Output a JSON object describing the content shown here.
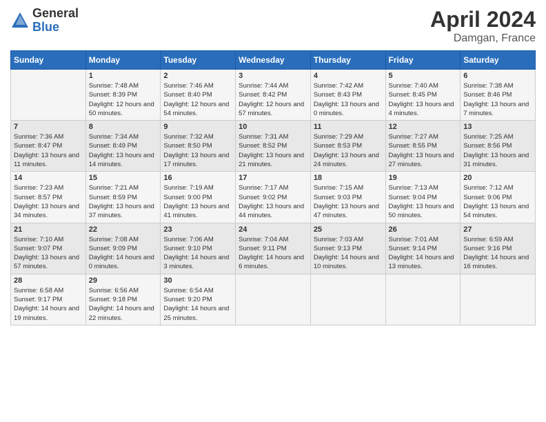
{
  "header": {
    "logo_general": "General",
    "logo_blue": "Blue",
    "month_title": "April 2024",
    "location": "Damgan, France"
  },
  "days_of_week": [
    "Sunday",
    "Monday",
    "Tuesday",
    "Wednesday",
    "Thursday",
    "Friday",
    "Saturday"
  ],
  "weeks": [
    [
      {
        "day": "",
        "sunrise": "",
        "sunset": "",
        "daylight": ""
      },
      {
        "day": "1",
        "sunrise": "Sunrise: 7:48 AM",
        "sunset": "Sunset: 8:39 PM",
        "daylight": "Daylight: 12 hours and 50 minutes."
      },
      {
        "day": "2",
        "sunrise": "Sunrise: 7:46 AM",
        "sunset": "Sunset: 8:40 PM",
        "daylight": "Daylight: 12 hours and 54 minutes."
      },
      {
        "day": "3",
        "sunrise": "Sunrise: 7:44 AM",
        "sunset": "Sunset: 8:42 PM",
        "daylight": "Daylight: 12 hours and 57 minutes."
      },
      {
        "day": "4",
        "sunrise": "Sunrise: 7:42 AM",
        "sunset": "Sunset: 8:43 PM",
        "daylight": "Daylight: 13 hours and 0 minutes."
      },
      {
        "day": "5",
        "sunrise": "Sunrise: 7:40 AM",
        "sunset": "Sunset: 8:45 PM",
        "daylight": "Daylight: 13 hours and 4 minutes."
      },
      {
        "day": "6",
        "sunrise": "Sunrise: 7:38 AM",
        "sunset": "Sunset: 8:46 PM",
        "daylight": "Daylight: 13 hours and 7 minutes."
      }
    ],
    [
      {
        "day": "7",
        "sunrise": "Sunrise: 7:36 AM",
        "sunset": "Sunset: 8:47 PM",
        "daylight": "Daylight: 13 hours and 11 minutes."
      },
      {
        "day": "8",
        "sunrise": "Sunrise: 7:34 AM",
        "sunset": "Sunset: 8:49 PM",
        "daylight": "Daylight: 13 hours and 14 minutes."
      },
      {
        "day": "9",
        "sunrise": "Sunrise: 7:32 AM",
        "sunset": "Sunset: 8:50 PM",
        "daylight": "Daylight: 13 hours and 17 minutes."
      },
      {
        "day": "10",
        "sunrise": "Sunrise: 7:31 AM",
        "sunset": "Sunset: 8:52 PM",
        "daylight": "Daylight: 13 hours and 21 minutes."
      },
      {
        "day": "11",
        "sunrise": "Sunrise: 7:29 AM",
        "sunset": "Sunset: 8:53 PM",
        "daylight": "Daylight: 13 hours and 24 minutes."
      },
      {
        "day": "12",
        "sunrise": "Sunrise: 7:27 AM",
        "sunset": "Sunset: 8:55 PM",
        "daylight": "Daylight: 13 hours and 27 minutes."
      },
      {
        "day": "13",
        "sunrise": "Sunrise: 7:25 AM",
        "sunset": "Sunset: 8:56 PM",
        "daylight": "Daylight: 13 hours and 31 minutes."
      }
    ],
    [
      {
        "day": "14",
        "sunrise": "Sunrise: 7:23 AM",
        "sunset": "Sunset: 8:57 PM",
        "daylight": "Daylight: 13 hours and 34 minutes."
      },
      {
        "day": "15",
        "sunrise": "Sunrise: 7:21 AM",
        "sunset": "Sunset: 8:59 PM",
        "daylight": "Daylight: 13 hours and 37 minutes."
      },
      {
        "day": "16",
        "sunrise": "Sunrise: 7:19 AM",
        "sunset": "Sunset: 9:00 PM",
        "daylight": "Daylight: 13 hours and 41 minutes."
      },
      {
        "day": "17",
        "sunrise": "Sunrise: 7:17 AM",
        "sunset": "Sunset: 9:02 PM",
        "daylight": "Daylight: 13 hours and 44 minutes."
      },
      {
        "day": "18",
        "sunrise": "Sunrise: 7:15 AM",
        "sunset": "Sunset: 9:03 PM",
        "daylight": "Daylight: 13 hours and 47 minutes."
      },
      {
        "day": "19",
        "sunrise": "Sunrise: 7:13 AM",
        "sunset": "Sunset: 9:04 PM",
        "daylight": "Daylight: 13 hours and 50 minutes."
      },
      {
        "day": "20",
        "sunrise": "Sunrise: 7:12 AM",
        "sunset": "Sunset: 9:06 PM",
        "daylight": "Daylight: 13 hours and 54 minutes."
      }
    ],
    [
      {
        "day": "21",
        "sunrise": "Sunrise: 7:10 AM",
        "sunset": "Sunset: 9:07 PM",
        "daylight": "Daylight: 13 hours and 57 minutes."
      },
      {
        "day": "22",
        "sunrise": "Sunrise: 7:08 AM",
        "sunset": "Sunset: 9:09 PM",
        "daylight": "Daylight: 14 hours and 0 minutes."
      },
      {
        "day": "23",
        "sunrise": "Sunrise: 7:06 AM",
        "sunset": "Sunset: 9:10 PM",
        "daylight": "Daylight: 14 hours and 3 minutes."
      },
      {
        "day": "24",
        "sunrise": "Sunrise: 7:04 AM",
        "sunset": "Sunset: 9:11 PM",
        "daylight": "Daylight: 14 hours and 6 minutes."
      },
      {
        "day": "25",
        "sunrise": "Sunrise: 7:03 AM",
        "sunset": "Sunset: 9:13 PM",
        "daylight": "Daylight: 14 hours and 10 minutes."
      },
      {
        "day": "26",
        "sunrise": "Sunrise: 7:01 AM",
        "sunset": "Sunset: 9:14 PM",
        "daylight": "Daylight: 14 hours and 13 minutes."
      },
      {
        "day": "27",
        "sunrise": "Sunrise: 6:59 AM",
        "sunset": "Sunset: 9:16 PM",
        "daylight": "Daylight: 14 hours and 16 minutes."
      }
    ],
    [
      {
        "day": "28",
        "sunrise": "Sunrise: 6:58 AM",
        "sunset": "Sunset: 9:17 PM",
        "daylight": "Daylight: 14 hours and 19 minutes."
      },
      {
        "day": "29",
        "sunrise": "Sunrise: 6:56 AM",
        "sunset": "Sunset: 9:18 PM",
        "daylight": "Daylight: 14 hours and 22 minutes."
      },
      {
        "day": "30",
        "sunrise": "Sunrise: 6:54 AM",
        "sunset": "Sunset: 9:20 PM",
        "daylight": "Daylight: 14 hours and 25 minutes."
      },
      {
        "day": "",
        "sunrise": "",
        "sunset": "",
        "daylight": ""
      },
      {
        "day": "",
        "sunrise": "",
        "sunset": "",
        "daylight": ""
      },
      {
        "day": "",
        "sunrise": "",
        "sunset": "",
        "daylight": ""
      },
      {
        "day": "",
        "sunrise": "",
        "sunset": "",
        "daylight": ""
      }
    ]
  ]
}
